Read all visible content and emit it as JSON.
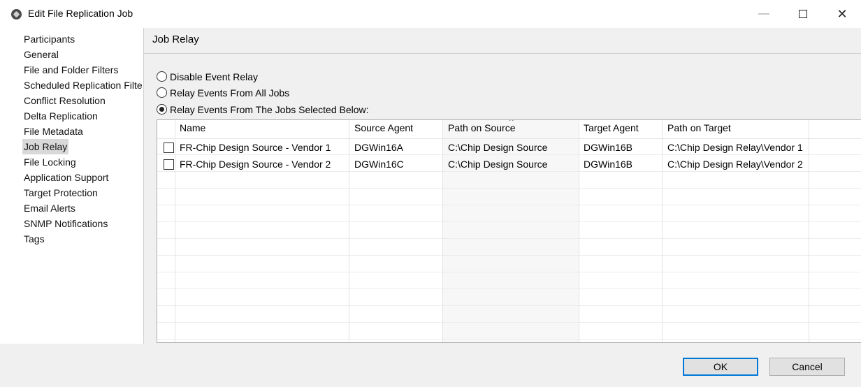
{
  "window": {
    "title": "Edit File Replication Job",
    "minimize_glyph": "—",
    "close_glyph": "✕"
  },
  "nav": {
    "items": [
      {
        "label": "Participants"
      },
      {
        "label": "General"
      },
      {
        "label": "File and Folder Filters"
      },
      {
        "label": "Scheduled Replication Filte"
      },
      {
        "label": "Conflict Resolution"
      },
      {
        "label": "Delta Replication"
      },
      {
        "label": "File Metadata"
      },
      {
        "label": "Job Relay",
        "selected": true
      },
      {
        "label": "File Locking"
      },
      {
        "label": "Application Support"
      },
      {
        "label": "Target Protection"
      },
      {
        "label": "Email Alerts"
      },
      {
        "label": "SNMP Notifications"
      },
      {
        "label": "Tags"
      }
    ],
    "scroll_left": "<",
    "scroll_right": ">"
  },
  "page": {
    "title": "Job Relay",
    "options": [
      {
        "label": "Disable Event Relay",
        "checked": false
      },
      {
        "label": "Relay Events From All Jobs",
        "checked": false
      },
      {
        "label": "Relay Events From The Jobs Selected Below:",
        "checked": true
      }
    ]
  },
  "table": {
    "columns": [
      "Name",
      "Source Agent",
      "Path on Source",
      "Target Agent",
      "Path on Target"
    ],
    "sort_indicator": "^",
    "rows": [
      {
        "name": "FR-Chip Design Source - Vendor 1",
        "source_agent": "DGWin16A",
        "path_source": "C:\\Chip Design Source",
        "target_agent": "DGWin16B",
        "path_target": "C:\\Chip Design Relay\\Vendor 1",
        "checked": false
      },
      {
        "name": "FR-Chip Design Source - Vendor 2",
        "source_agent": "DGWin16C",
        "path_source": "C:\\Chip Design Source",
        "target_agent": "DGWin16B",
        "path_target": "C:\\Chip Design Relay\\Vendor 2",
        "checked": false
      }
    ]
  },
  "footer": {
    "ok_label": "OK",
    "cancel_label": "Cancel"
  }
}
